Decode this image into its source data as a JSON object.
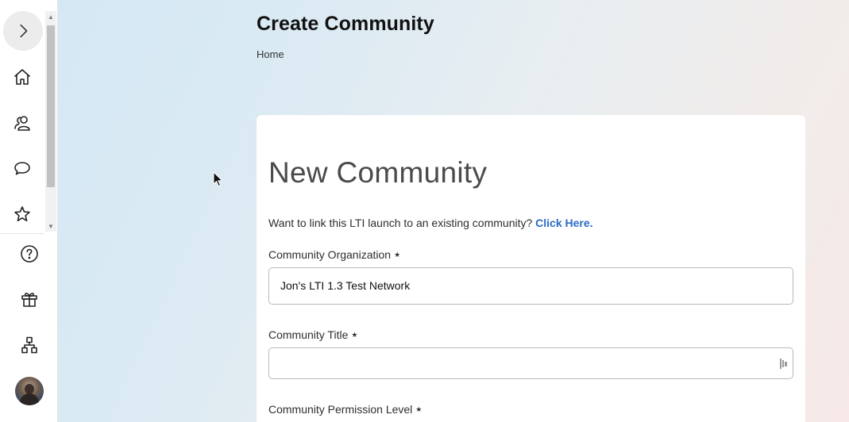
{
  "header": {
    "title": "Create Community",
    "breadcrumb": "Home"
  },
  "rail": {
    "top_items": [
      {
        "icon": "chevron-right-icon"
      },
      {
        "icon": "home-icon"
      },
      {
        "icon": "people-icon"
      },
      {
        "icon": "chat-icon"
      },
      {
        "icon": "star-icon"
      }
    ],
    "bottom_items": [
      {
        "icon": "help-icon"
      },
      {
        "icon": "gift-icon"
      },
      {
        "icon": "hierarchy-icon"
      },
      {
        "icon": "avatar"
      }
    ]
  },
  "form": {
    "heading": "New Community",
    "link_prompt": "Want to link this LTI launch to an existing community?",
    "link_text": "Click Here.",
    "fields": {
      "organization": {
        "label": "Community Organization",
        "value": "Jon's LTI 1.3 Test Network"
      },
      "title": {
        "label": "Community Title",
        "value": ""
      },
      "permission": {
        "label": "Community Permission Level"
      }
    },
    "required_marker": "★"
  },
  "colors": {
    "link": "#2a6bc6",
    "rail_bg": "#ffffff"
  }
}
